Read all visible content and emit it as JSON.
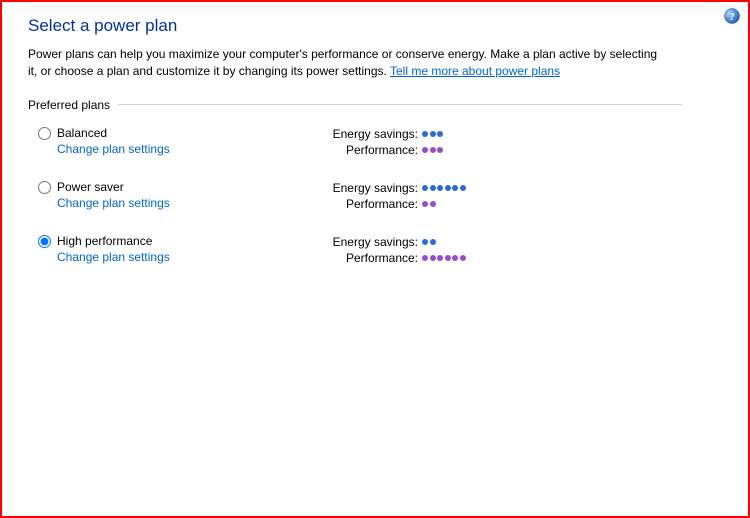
{
  "title": "Select a power plan",
  "description_pre": "Power plans can help you maximize your computer's performance or conserve energy. Make a plan active by selecting it, or choose a plan and customize it by changing its power settings. ",
  "description_link": "Tell me more about power plans",
  "section_label": "Preferred plans",
  "change_link_label": "Change plan settings",
  "metric_labels": {
    "energy": "Energy savings:",
    "performance": "Performance:"
  },
  "plans": [
    {
      "name": "Balanced",
      "selected": false,
      "energy_dots": 3,
      "performance_dots": 3
    },
    {
      "name": "Power saver",
      "selected": false,
      "energy_dots": 6,
      "performance_dots": 2
    },
    {
      "name": "High performance",
      "selected": true,
      "energy_dots": 2,
      "performance_dots": 6
    }
  ]
}
